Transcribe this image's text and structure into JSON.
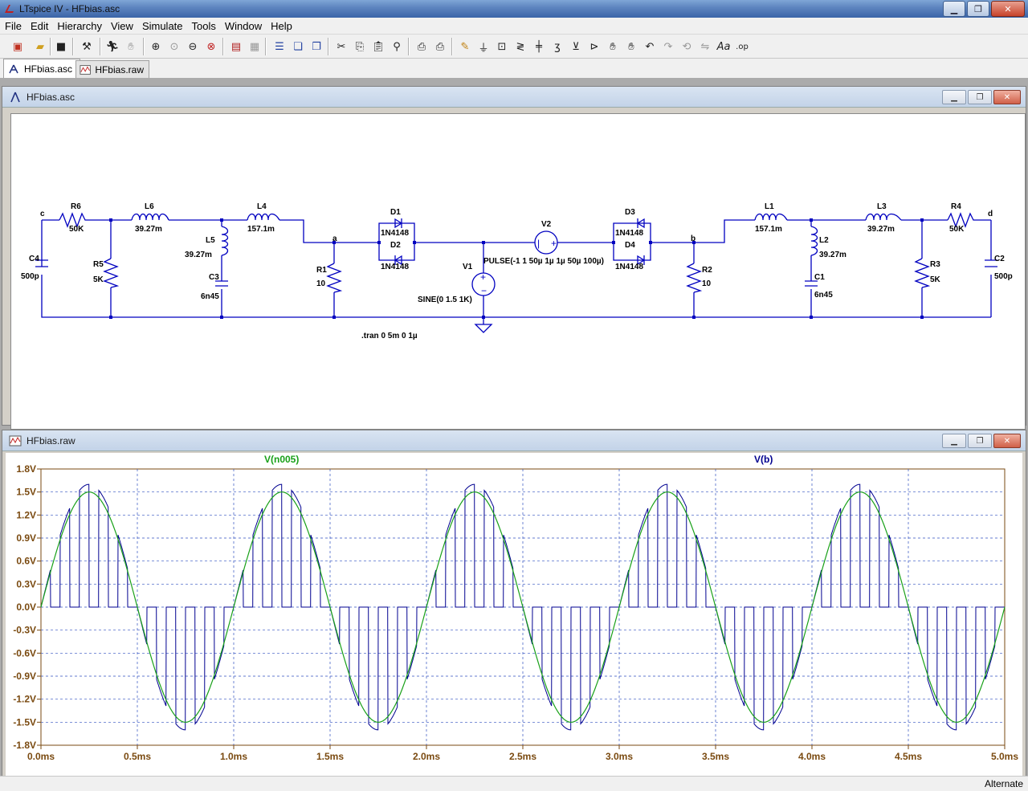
{
  "window": {
    "title": "LTspice IV - HFbias.asc"
  },
  "menu": [
    "File",
    "Edit",
    "Hierarchy",
    "View",
    "Simulate",
    "Tools",
    "Window",
    "Help"
  ],
  "tabs": [
    {
      "label": "HFbias.asc",
      "active": true,
      "icon": "schematic-icon"
    },
    {
      "label": "HFbias.raw",
      "active": false,
      "icon": "waveform-icon"
    }
  ],
  "schematic": {
    "title": "HFbias.asc",
    "nodes": {
      "c": "c",
      "a": "a",
      "b": "b",
      "d": "d"
    },
    "components": {
      "R6": {
        "name": "R6",
        "value": "50K"
      },
      "L6": {
        "name": "L6",
        "value": "39.27m"
      },
      "L4": {
        "name": "L4",
        "value": "157.1m"
      },
      "D1": {
        "name": "D1",
        "value": "1N4148"
      },
      "D2": {
        "name": "D2",
        "value": "1N4148"
      },
      "V2": {
        "name": "V2",
        "value": "PULSE(-1 1 50µ 1µ 1µ 50µ 100µ)"
      },
      "D3": {
        "name": "D3",
        "value": "1N4148"
      },
      "D4": {
        "name": "D4",
        "value": "1N4148"
      },
      "L1": {
        "name": "L1",
        "value": "157.1m"
      },
      "L3": {
        "name": "L3",
        "value": "39.27m"
      },
      "R4": {
        "name": "R4",
        "value": "50K"
      },
      "C4": {
        "name": "C4",
        "value": "500p"
      },
      "R5": {
        "name": "R5",
        "value": "5K"
      },
      "L5": {
        "name": "L5",
        "value": "39.27m"
      },
      "C3": {
        "name": "C3",
        "value": "6n45"
      },
      "R1": {
        "name": "R1",
        "value": "10"
      },
      "V1": {
        "name": "V1",
        "value": "SINE(0 1.5 1K)"
      },
      "R2": {
        "name": "R2",
        "value": "10"
      },
      "L2": {
        "name": "L2",
        "value": "39.27m"
      },
      "C1": {
        "name": "C1",
        "value": "6n45"
      },
      "R3": {
        "name": "R3",
        "value": "5K"
      },
      "C2": {
        "name": "C2",
        "value": "500p"
      }
    },
    "directive": ".tran 0 5m 0 1µ"
  },
  "waveform": {
    "title": "HFbias.raw",
    "trace1_label": "V(n005)",
    "trace2_label": "V(b)",
    "colors": {
      "trace1": "#18a018",
      "trace2": "#000090",
      "axis": "#7a4a10",
      "grid": "#3050c0"
    }
  },
  "chart_data": {
    "type": "line",
    "title": "",
    "xlabel": "",
    "ylabel": "",
    "xlim": [
      0,
      5.0
    ],
    "ylim": [
      -1.8,
      1.8
    ],
    "x_ticks": [
      "0.0ms",
      "0.5ms",
      "1.0ms",
      "1.5ms",
      "2.0ms",
      "2.5ms",
      "3.0ms",
      "3.5ms",
      "4.0ms",
      "4.5ms",
      "5.0ms"
    ],
    "y_ticks": [
      "1.8V",
      "1.5V",
      "1.2V",
      "0.9V",
      "0.6V",
      "0.3V",
      "0.0V",
      "-0.3V",
      "-0.6V",
      "-0.9V",
      "-1.2V",
      "-1.5V",
      "-1.8V"
    ],
    "series": [
      {
        "name": "V(n005)",
        "description_fn": "sine",
        "amplitude": 1.5,
        "frequency_khz": 1.0,
        "x_unit": "ms"
      },
      {
        "name": "V(b)",
        "description_fn": "sine_chopped_by_10kHz_square",
        "amplitude": 1.6,
        "frequency_khz": 1.0,
        "x_unit": "ms"
      }
    ],
    "grid": true
  },
  "status": {
    "text": "Alternate"
  }
}
